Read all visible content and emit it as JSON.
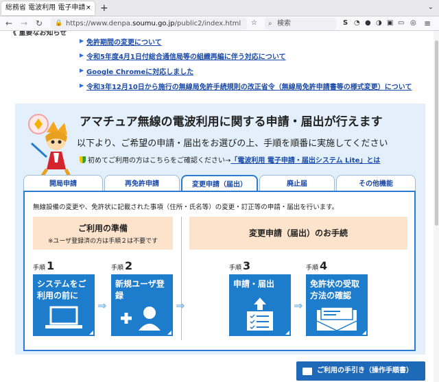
{
  "browser": {
    "tab_title": "総務省 電波利用 電子申請・",
    "tab_close": "×",
    "new_tab": "+",
    "tab_menu": "⌄",
    "back": "←",
    "forward": "→",
    "reload": "↻",
    "url_prefix": "https://www.denpa.",
    "url_domain": "soumu.go.jp",
    "url_path": "/public2/index.html",
    "search_placeholder": "検索",
    "menu_icon": "≡"
  },
  "news": {
    "cut_header": "《 重要なお知らせ",
    "items": [
      "免許期間の変更について",
      "令和5年度4月1日付総合通信局等の組織再編に伴う対応について",
      "Google Chromeに対応しました",
      "令和3年12月10日から施行の無線局免許手続規則の改正省令（無線局免許申請書等の様式変更）について"
    ]
  },
  "main": {
    "heading": "アマチュア無線の電波利用に関する申請・届出が行えます",
    "subheading": "以下より、ご希望の申請・届出をお選びの上、手順を順番に実施してください",
    "firsttime_text": "初めてご利用の方はこちらをご確認ください→",
    "firsttime_link": "「電波利用 電子申請・届出システム Lite」とは"
  },
  "tabs": [
    {
      "label": "開局申請"
    },
    {
      "label": "再免許申請"
    },
    {
      "label": "変更申請（届出）"
    },
    {
      "label": "廃止届"
    },
    {
      "label": "その他機能"
    }
  ],
  "card": {
    "description": "無線設備の変更や、免許状に記載された事項（住所・氏名等）の変更・訂正等の申請・届出を行います。",
    "prep_title": "ご利用の準備",
    "prep_note": "※ユーザ登録済の方は手順２は不要です",
    "proc_title": "変更申請（届出）のお手続",
    "step_prefix": "手順",
    "steps": [
      {
        "num": "1",
        "label": "システムをご利用の前に"
      },
      {
        "num": "2",
        "label": "新規ユーザ登録"
      },
      {
        "num": "3",
        "label": "申請・届出"
      },
      {
        "num": "4",
        "label": "免許状の受取方法の確認"
      }
    ],
    "arrow": "⇒"
  },
  "manual_button": "ご利用の手引き（操作手順書）",
  "colors": {
    "accent": "#1e7ccc",
    "panel_bg": "#e3f0fb",
    "step_header_bg": "#fde3cc",
    "link": "#1a4aa8"
  }
}
